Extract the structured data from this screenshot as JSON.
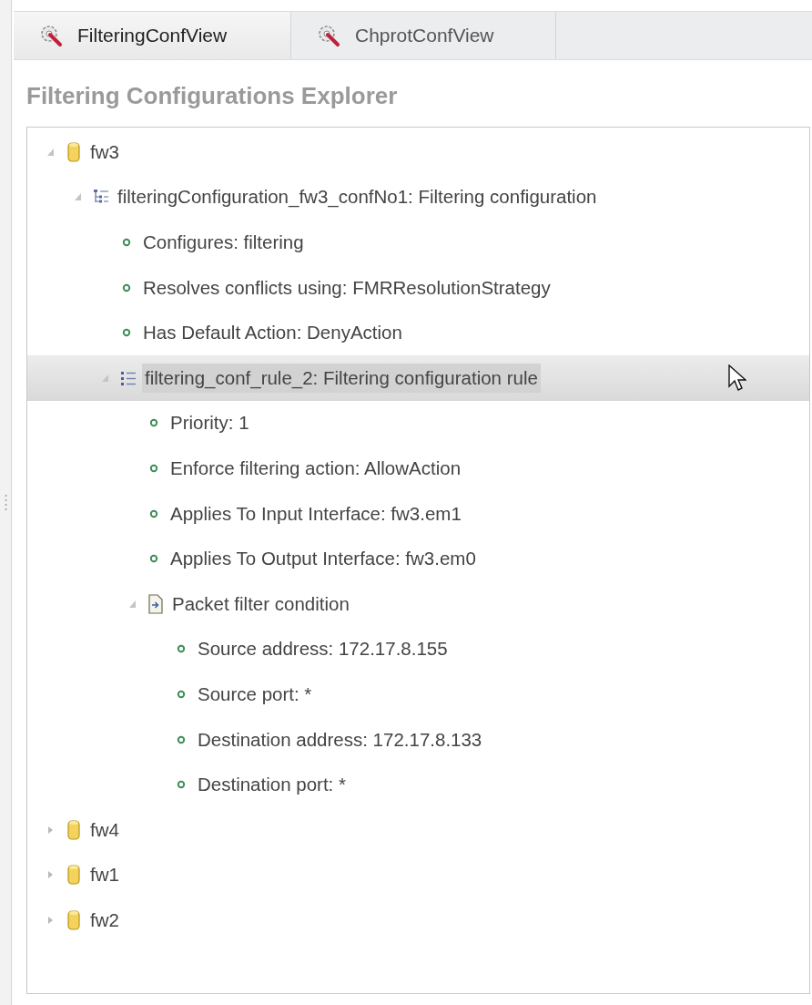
{
  "tabs": [
    {
      "label": "FilteringConfView",
      "selected": true
    },
    {
      "label": "ChprotConfView",
      "selected": false
    }
  ],
  "explorer": {
    "title": "Filtering Configurations Explorer",
    "tree": [
      {
        "kind": "firewall",
        "label": "fw3",
        "expanded": true,
        "selected": false,
        "children": [
          {
            "kind": "configuration",
            "label": "filteringConfiguration_fw3_confNo1: Filtering configuration",
            "expanded": true,
            "selected": false,
            "children": [
              {
                "kind": "property",
                "label": "Configures: filtering",
                "selected": false
              },
              {
                "kind": "property",
                "label": "Resolves conflicts using: FMRResolutionStrategy",
                "selected": false
              },
              {
                "kind": "property",
                "label": "Has Default Action: DenyAction",
                "selected": false
              },
              {
                "kind": "rule",
                "label": "filtering_conf_rule_2: Filtering configuration rule",
                "expanded": true,
                "selected": true,
                "children": [
                  {
                    "kind": "property",
                    "label": "Priority: 1",
                    "selected": false
                  },
                  {
                    "kind": "property",
                    "label": "Enforce filtering action: AllowAction",
                    "selected": false
                  },
                  {
                    "kind": "property",
                    "label": "Applies To Input Interface: fw3.em1",
                    "selected": false
                  },
                  {
                    "kind": "property",
                    "label": "Applies To Output Interface: fw3.em0",
                    "selected": false
                  },
                  {
                    "kind": "condition",
                    "label": "Packet filter condition",
                    "expanded": true,
                    "selected": false,
                    "children": [
                      {
                        "kind": "property",
                        "label": "Source address: 172.17.8.155",
                        "selected": false
                      },
                      {
                        "kind": "property",
                        "label": "Source port: *",
                        "selected": false
                      },
                      {
                        "kind": "property",
                        "label": "Destination address: 172.17.8.133",
                        "selected": false
                      },
                      {
                        "kind": "property",
                        "label": "Destination port: *",
                        "selected": false
                      }
                    ]
                  }
                ]
              }
            ]
          }
        ]
      },
      {
        "kind": "firewall",
        "label": "fw4",
        "expanded": false,
        "selected": false
      },
      {
        "kind": "firewall",
        "label": "fw1",
        "expanded": false,
        "selected": false
      },
      {
        "kind": "firewall",
        "label": "fw2",
        "expanded": false,
        "selected": false
      }
    ]
  }
}
